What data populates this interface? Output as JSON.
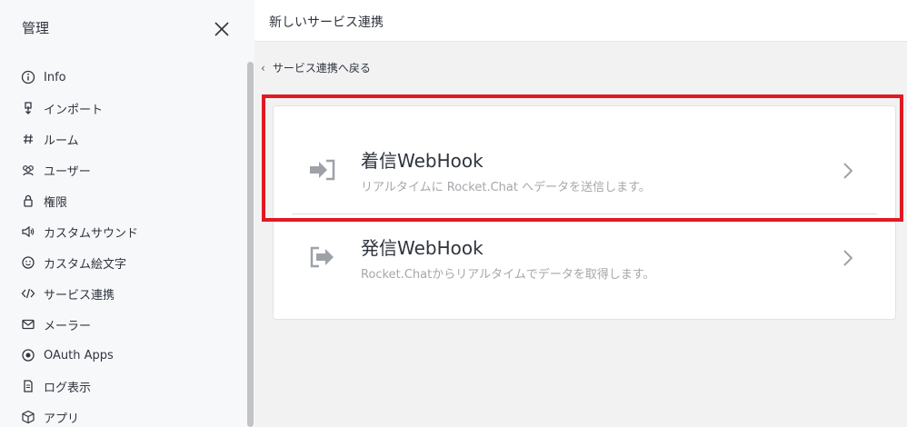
{
  "sidebar": {
    "title": "管理",
    "items": [
      {
        "label": "Info",
        "icon": "info-icon"
      },
      {
        "label": "インポート",
        "icon": "import-icon"
      },
      {
        "label": "ルーム",
        "icon": "hashtag-icon"
      },
      {
        "label": "ユーザー",
        "icon": "users-icon"
      },
      {
        "label": "権限",
        "icon": "lock-icon"
      },
      {
        "label": "カスタムサウンド",
        "icon": "sound-icon"
      },
      {
        "label": "カスタム絵文字",
        "icon": "emoji-icon"
      },
      {
        "label": "サービス連携",
        "icon": "code-icon"
      },
      {
        "label": "メーラー",
        "icon": "mail-icon"
      },
      {
        "label": "OAuth Apps",
        "icon": "oauth-icon"
      },
      {
        "label": "ログ表示",
        "icon": "log-icon"
      },
      {
        "label": "アプリ",
        "icon": "cube-icon"
      }
    ]
  },
  "header": {
    "title": "新しいサービス連携"
  },
  "back_link": "サービス連携へ戻る",
  "options": [
    {
      "title": "着信WebHook",
      "description": "リアルタイムに Rocket.Chat へデータを送信します。",
      "icon": "incoming-webhook-icon"
    },
    {
      "title": "発信WebHook",
      "description": "Rocket.Chatからリアルタイムでデータを取得します。",
      "icon": "outgoing-webhook-icon"
    }
  ],
  "colors": {
    "highlight": "#e11a22",
    "icon_gray": "#9ea2a8"
  }
}
